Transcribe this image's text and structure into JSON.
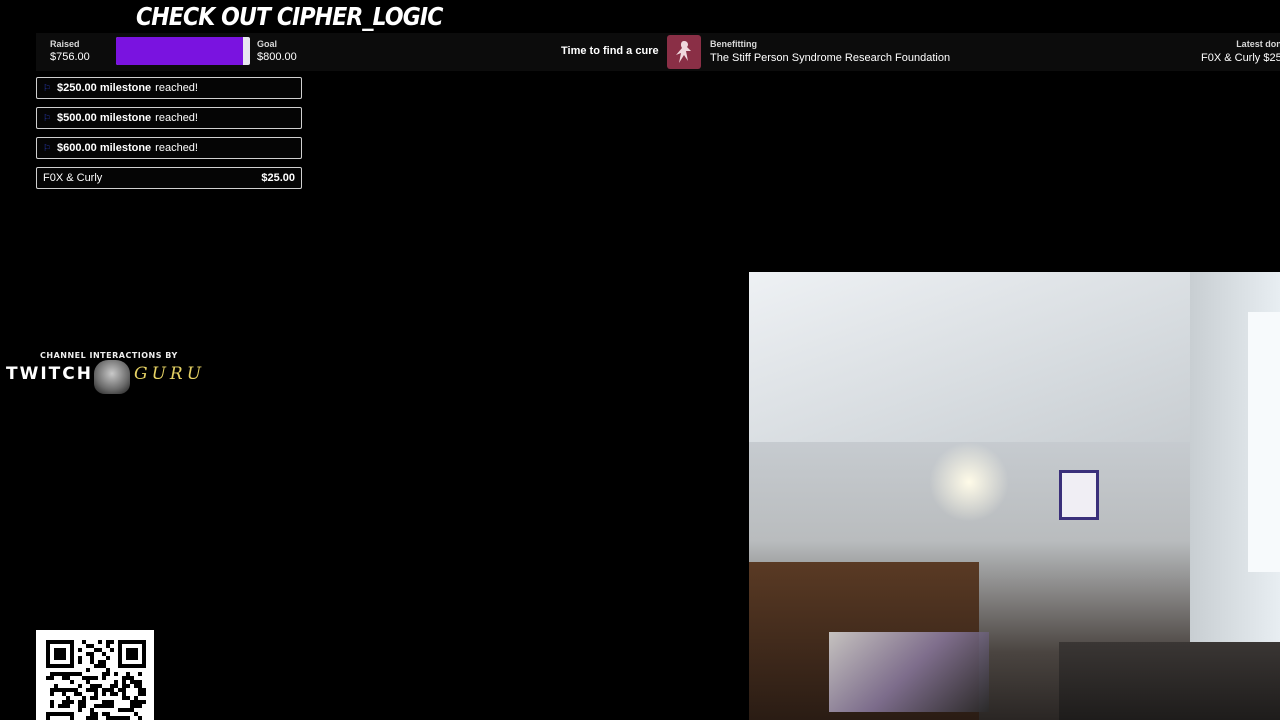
{
  "overlay": {
    "headline": "CHECK OUT CIPHER_LOGIC"
  },
  "fundraiser": {
    "raised_label": "Raised",
    "raised_value": "$756.00",
    "goal_label": "Goal",
    "goal_value": "$800.00",
    "progress_fraction": 0.945,
    "tagline": "Time to find a cure",
    "benefitting_label": "Benefitting",
    "charity_name": "The Stiff Person Syndrome Research Foundation",
    "latest_label": "Latest don",
    "latest_value": "F0X & Curly $25",
    "progress_color": "#7a13e0"
  },
  "milestones": [
    {
      "amount": "$250.00 milestone",
      "suffix": "reached!"
    },
    {
      "amount": "$500.00 milestone",
      "suffix": "reached!"
    },
    {
      "amount": "$600.00 milestone",
      "suffix": "reached!"
    }
  ],
  "recent_donation": {
    "name": "F0X & Curly",
    "amount": "$25.00"
  },
  "credit": {
    "small_text": "CHANNEL INTERACTIONS BY",
    "brand_left": "TWITCH",
    "brand_right": "GURU"
  },
  "icons": {
    "milestone_flag": "flag-icon",
    "charity_logo": "charity-logo",
    "qr": "qr-code"
  }
}
